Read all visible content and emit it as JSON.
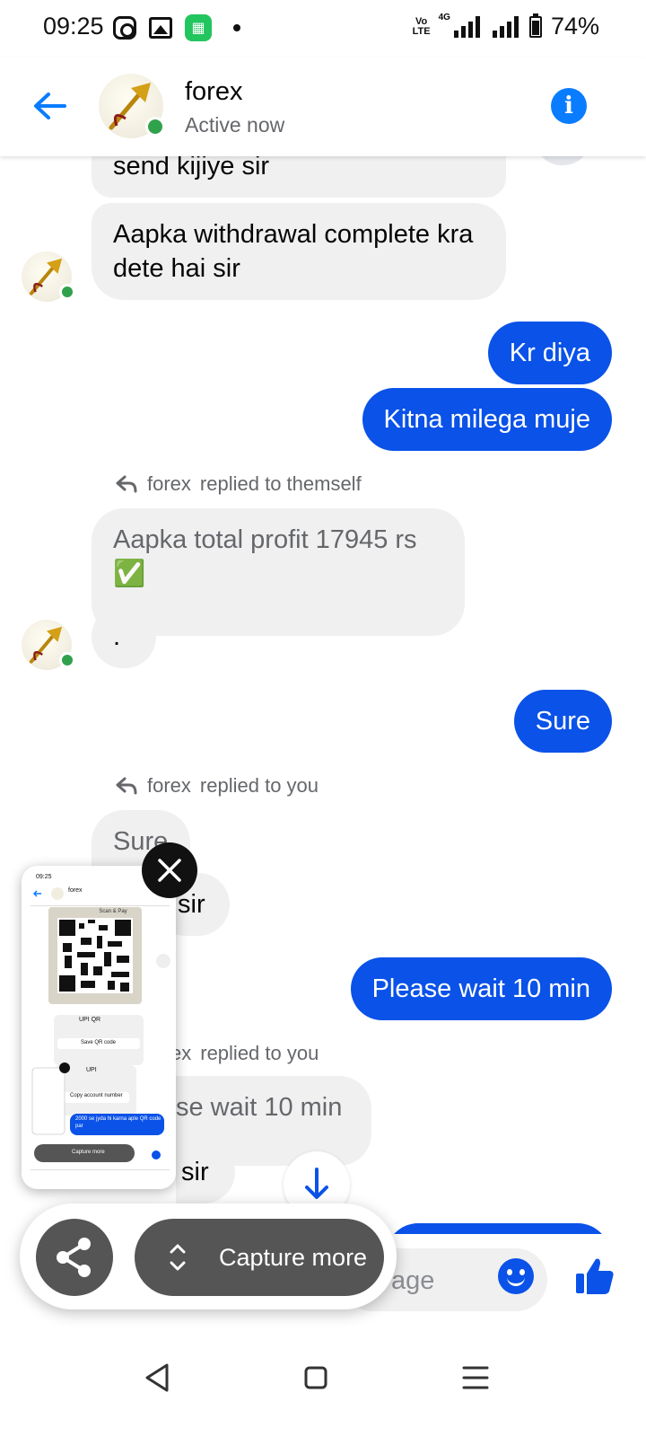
{
  "status_bar": {
    "time": "09:25",
    "network": "4G",
    "volte": "Vo LTE",
    "battery": "74%"
  },
  "header": {
    "name": "forex",
    "status": "Active now"
  },
  "messages": [
    {
      "dir": "in",
      "text": "send kijiye sir"
    },
    {
      "dir": "in",
      "text": "Aapka withdrawal complete kra dete hai sir"
    },
    {
      "dir": "out",
      "text": "Kr diya"
    },
    {
      "dir": "out",
      "text": "Kitna milega muje"
    },
    {
      "dir": "note",
      "sender": "forex",
      "text": "replied to themself"
    },
    {
      "dir": "in",
      "text": "Aapka total profit 17945 rs ✅"
    },
    {
      "dir": "in",
      "text": "."
    },
    {
      "dir": "out",
      "text": "Sure"
    },
    {
      "dir": "note",
      "sender": "forex",
      "text": "replied to you"
    },
    {
      "dir": "in",
      "text": "Sure"
    },
    {
      "dir": "in",
      "text": "sir"
    },
    {
      "dir": "out",
      "text": "Please wait 10 min"
    },
    {
      "dir": "note",
      "sender": "forex",
      "text": "replied to you"
    },
    {
      "dir": "in",
      "text": "se wait 10 min"
    },
    {
      "dir": "in",
      "text": "sir"
    }
  ],
  "composer": {
    "placeholder": "age"
  },
  "capture": {
    "capture_more_label": "Capture more"
  },
  "thumbnail": {
    "title": "Scan & Pay",
    "name": "forex",
    "upi_qr": "UPI QR",
    "save_qr": "Save QR code",
    "upi": "UPI",
    "copy_account": "Copy account number",
    "message": "2000 se jyda hi karna aple QR code par",
    "capture_more": "Capture more"
  },
  "colors": {
    "messenger_blue": "#0a52e8",
    "incoming_bg": "#f0f0f0",
    "online_green": "#31a24c"
  }
}
